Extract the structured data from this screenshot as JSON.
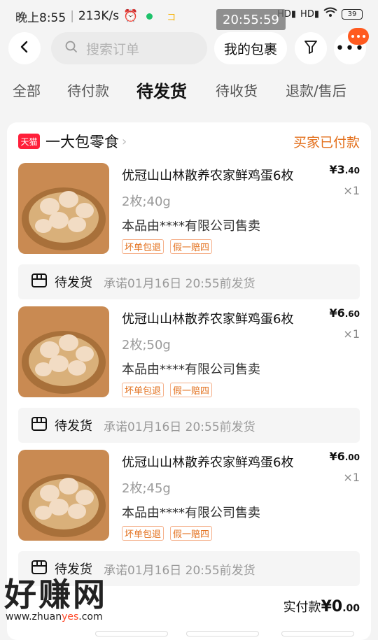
{
  "status_bar": {
    "time_left": "晚上8:55",
    "speed": "213K/s",
    "app_mini": "コ",
    "time_overlay": "20:55:59",
    "battery": "39"
  },
  "top_bar": {
    "search_placeholder": "搜索订单",
    "packages_label": "我的包裹"
  },
  "tabs": [
    {
      "label": "全部",
      "active": false
    },
    {
      "label": "待付款",
      "active": false
    },
    {
      "label": "待发货",
      "active": true
    },
    {
      "label": "待收货",
      "active": false
    },
    {
      "label": "退款/售后",
      "active": false
    }
  ],
  "order": {
    "shop_badge": "天猫",
    "shop_name": "一大包零食",
    "status": "买家已付款",
    "items": [
      {
        "title": "优冠山山林散养农家鲜鸡蛋6枚",
        "spec": "2枚;40g",
        "seller": "本品由****有限公司售卖",
        "tags": [
          "坏单包退",
          "假一赔四"
        ],
        "price_symbol": "¥",
        "price_int": "3",
        "price_dec": ".40",
        "qty": "×1",
        "ship_label": "待发货",
        "ship_note": "承诺01月16日 20:55前发货"
      },
      {
        "title": "优冠山山林散养农家鲜鸡蛋6枚",
        "spec": "2枚;50g",
        "seller": "本品由****有限公司售卖",
        "tags": [
          "坏单包退",
          "假一赔四"
        ],
        "price_symbol": "¥",
        "price_int": "6",
        "price_dec": ".60",
        "qty": "×1",
        "ship_label": "待发货",
        "ship_note": "承诺01月16日 20:55前发货"
      },
      {
        "title": "优冠山山林散养农家鲜鸡蛋6枚",
        "spec": "2枚;45g",
        "seller": "本品由****有限公司售卖",
        "tags": [
          "坏单包退",
          "假一赔四"
        ],
        "price_symbol": "¥",
        "price_int": "6",
        "price_dec": ".00",
        "qty": "×1",
        "ship_label": "待发货",
        "ship_note": "承诺01月16日 20:55前发货"
      }
    ],
    "total_label": "实付款",
    "total_symbol": "¥",
    "total_int": "0",
    "total_dec": ".00"
  },
  "watermark": {
    "main": "好赚网",
    "sub_a": "www.zhuan",
    "sub_b": "yes",
    "sub_c": ".com"
  },
  "colors": {
    "accent_orange": "#e3701d",
    "tmall_red": "#ff1f3a",
    "badge_orange": "#ff5a1f"
  }
}
